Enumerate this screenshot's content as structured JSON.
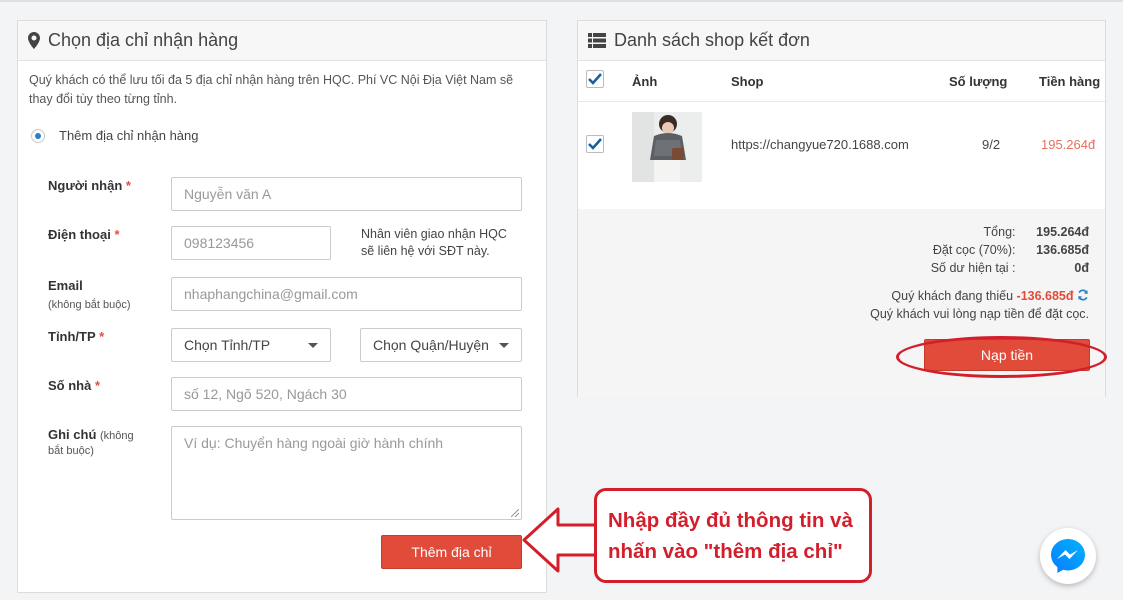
{
  "address_panel": {
    "title": "Chọn địa chỉ nhận hàng",
    "icon": "map-marker-icon",
    "intro": "Quý khách có thể lưu tối đa 5 địa chỉ nhận hàng trên HQC. Phí VC Nội Địa Việt Nam sẽ thay đổi tùy theo từng tỉnh.",
    "radio_label": "Thêm địa chỉ nhận hàng",
    "fields": {
      "recipient": {
        "label": "Người nhận",
        "required": "*",
        "placeholder": "Nguyễn văn A"
      },
      "phone": {
        "label": "Điện thoại",
        "required": "*",
        "placeholder": "098123456",
        "hint": "Nhân viên giao nhận HQC sẽ liên hệ với SĐT này."
      },
      "email": {
        "label": "Email",
        "sub": "(không bắt buộc)",
        "placeholder": "nhaphangchina@gmail.com"
      },
      "province": {
        "label": "Tỉnh/TP",
        "required": "*",
        "province_value": "Chọn Tỉnh/TP",
        "district_value": "Chọn Quận/Huyện"
      },
      "house": {
        "label": "Số nhà",
        "required": "*",
        "placeholder": "số 12, Ngõ 520, Ngách 30"
      },
      "note": {
        "label": "Ghi chú",
        "sub": "(không bắt buộc)",
        "placeholder": "Ví dụ: Chuyển hàng ngoài giờ hành chính"
      }
    },
    "submit_label": "Thêm địa chỉ"
  },
  "shop_panel": {
    "title": "Danh sách shop kết đơn",
    "icon": "list-icon",
    "columns": {
      "image": "Ảnh",
      "shop": "Shop",
      "quantity": "Số lượng",
      "amount": "Tiền hàng"
    },
    "rows": [
      {
        "shop": "https://changyue720.1688.com",
        "quantity": "9/2",
        "amount": "195.264đ",
        "checked": true
      }
    ],
    "summary": {
      "total_label": "Tổng:",
      "total_value": "195.264đ",
      "deposit_label": "Đặt cọc (70%):",
      "deposit_value": "136.685đ",
      "balance_label": "Số dư hiện tại :",
      "balance_value": "0đ",
      "shortage_text": "Quý khách đang thiếu",
      "shortage_value": "-136.685đ",
      "topup_note": "Quý khách vui lòng nạp tiền để đặt cọc."
    },
    "topup_label": "Nạp tiền"
  },
  "annotation": {
    "line1": "Nhập đầy đủ thông tin và",
    "line2": "nhấn vào \"thêm địa chỉ\""
  },
  "colors": {
    "accent_red": "#e04b3a",
    "annotation_red": "#d21f2b",
    "checkbox_blue": "#1a5fa0"
  }
}
